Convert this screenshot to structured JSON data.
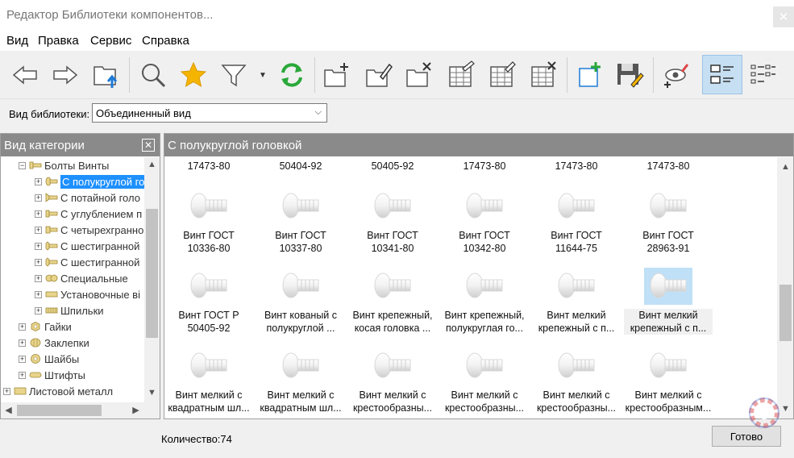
{
  "window": {
    "title": "Редактор Библиотеки компонентов..."
  },
  "menu": [
    "Вид",
    "Правка",
    "Сервис",
    "Справка"
  ],
  "toolbar": {
    "buttons": [
      {
        "icon": "back-arrow-icon"
      },
      {
        "icon": "forward-arrow-icon"
      },
      {
        "icon": "export-folder-icon"
      },
      {
        "icon": "search-icon"
      },
      {
        "icon": "favorite-star-icon"
      },
      {
        "icon": "filter-icon"
      },
      {
        "icon": "refresh-icon"
      },
      {
        "icon": "new-folder-icon"
      },
      {
        "icon": "edit-folder-icon"
      },
      {
        "icon": "delete-folder-icon"
      },
      {
        "icon": "new-table-icon"
      },
      {
        "icon": "edit-table-icon"
      },
      {
        "icon": "delete-table-icon"
      },
      {
        "icon": "add-item-icon"
      },
      {
        "icon": "save-edit-icon"
      },
      {
        "icon": "properties-icon"
      },
      {
        "icon": "view-details-icon"
      },
      {
        "icon": "view-list-icon"
      }
    ]
  },
  "library_view": {
    "label": "Вид библиотеки:",
    "value": "Объединенный вид"
  },
  "category_panel": {
    "title": "Вид категории",
    "tree": [
      {
        "label": "Болты  Винты",
        "expanded": true
      },
      {
        "label": "С полукруглой го",
        "selected": true
      },
      {
        "label": "С потайной голо"
      },
      {
        "label": "С углублением п"
      },
      {
        "label": "С четырехгранно"
      },
      {
        "label": "С шестигранной"
      },
      {
        "label": "С шестигранной"
      },
      {
        "label": "Специальные"
      },
      {
        "label": "Установочные ві"
      },
      {
        "label": "Шпильки"
      },
      {
        "label": "Гайки"
      },
      {
        "label": "Заклепки"
      },
      {
        "label": "Шайбы"
      },
      {
        "label": "Штифты"
      },
      {
        "label": "Листовой металл"
      }
    ]
  },
  "items_panel": {
    "title": "С полукруглой головкой",
    "top_row": [
      "17473-80",
      "50404-92",
      "50405-92",
      "17473-80",
      "17473-80",
      "17473-80"
    ],
    "rows": [
      [
        {
          "l1": "Винт ГОСТ",
          "l2": "10336-80"
        },
        {
          "l1": "Винт ГОСТ",
          "l2": "10337-80"
        },
        {
          "l1": "Винт ГОСТ",
          "l2": "10341-80"
        },
        {
          "l1": "Винт ГОСТ",
          "l2": "10342-80"
        },
        {
          "l1": "Винт ГОСТ",
          "l2": "11644-75"
        },
        {
          "l1": "Винт ГОСТ",
          "l2": "28963-91"
        }
      ],
      [
        {
          "l1": "Винт ГОСТ Р",
          "l2": "50405-92"
        },
        {
          "l1": "Винт кованый с",
          "l2": "полукруглой ..."
        },
        {
          "l1": "Винт крепежный,",
          "l2": "косая головка ..."
        },
        {
          "l1": "Винт крепежный,",
          "l2": "полукруглая го..."
        },
        {
          "l1": "Винт мелкий",
          "l2": "крепежный с п..."
        },
        {
          "l1": "Винт мелкий",
          "l2": "крепежный с п..."
        }
      ],
      [
        {
          "l1": "Винт мелкий с",
          "l2": "квадратным шл..."
        },
        {
          "l1": "Винт мелкий с",
          "l2": "квадратным шл..."
        },
        {
          "l1": "Винт мелкий с",
          "l2": "крестообразны..."
        },
        {
          "l1": "Винт мелкий с",
          "l2": "крестообразны..."
        },
        {
          "l1": "Винт мелкий с",
          "l2": "крестообразны..."
        },
        {
          "l1": "Винт мелкий с",
          "l2": "крестообразным..."
        }
      ]
    ]
  },
  "footer": {
    "count_label": "Количество:74",
    "done_label": "Готово"
  },
  "colors": {
    "selection": "#1e90ff",
    "panel_header": "#8a8a8a",
    "toolbar_active": "#c6dff2"
  }
}
